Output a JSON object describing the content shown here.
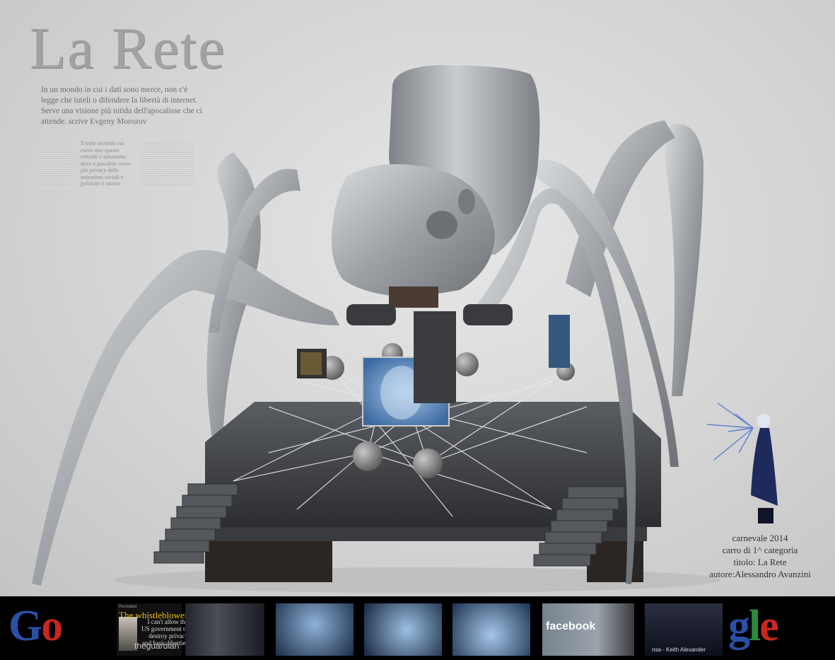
{
  "poster": {
    "title": "La Rete",
    "clipping_quote": "In un mondo in cui i dati sono merce, non c'è legge che tuteli o difendere la libertà di internet. Serve una visione più nitida dell'apocalisse che ci attende. scrive Evgeny Morozov",
    "clipping_columns": [
      "Il mito secondo cui esiste uno spazio virtuale e autonomo dove è possibile avere più privacy dalle istituzioni sociali e politiche è muoro"
    ],
    "caption": {
      "line1": "carnevale 2014",
      "line2": "carro di 1^ categoria",
      "line3": "titolo: La Rete",
      "line4": "autore:Alessandro Avanzini"
    }
  },
  "strip": {
    "google_left": "Go",
    "google_right": "gle",
    "whistleblower": {
      "kicker": "Revealed",
      "title": "The whistleblower",
      "text": "I can't allow the US government to destroy privacy and basic liberties",
      "source": "theguardian"
    },
    "facebook": "facebook",
    "nsa": "nsa - Keith Alexander"
  },
  "colors": {
    "google_blue": "#2850a8",
    "google_red": "#c8281e",
    "google_green": "#2a8c3c",
    "spider_silver": "#a9adb1",
    "strip_bg": "#000000"
  }
}
